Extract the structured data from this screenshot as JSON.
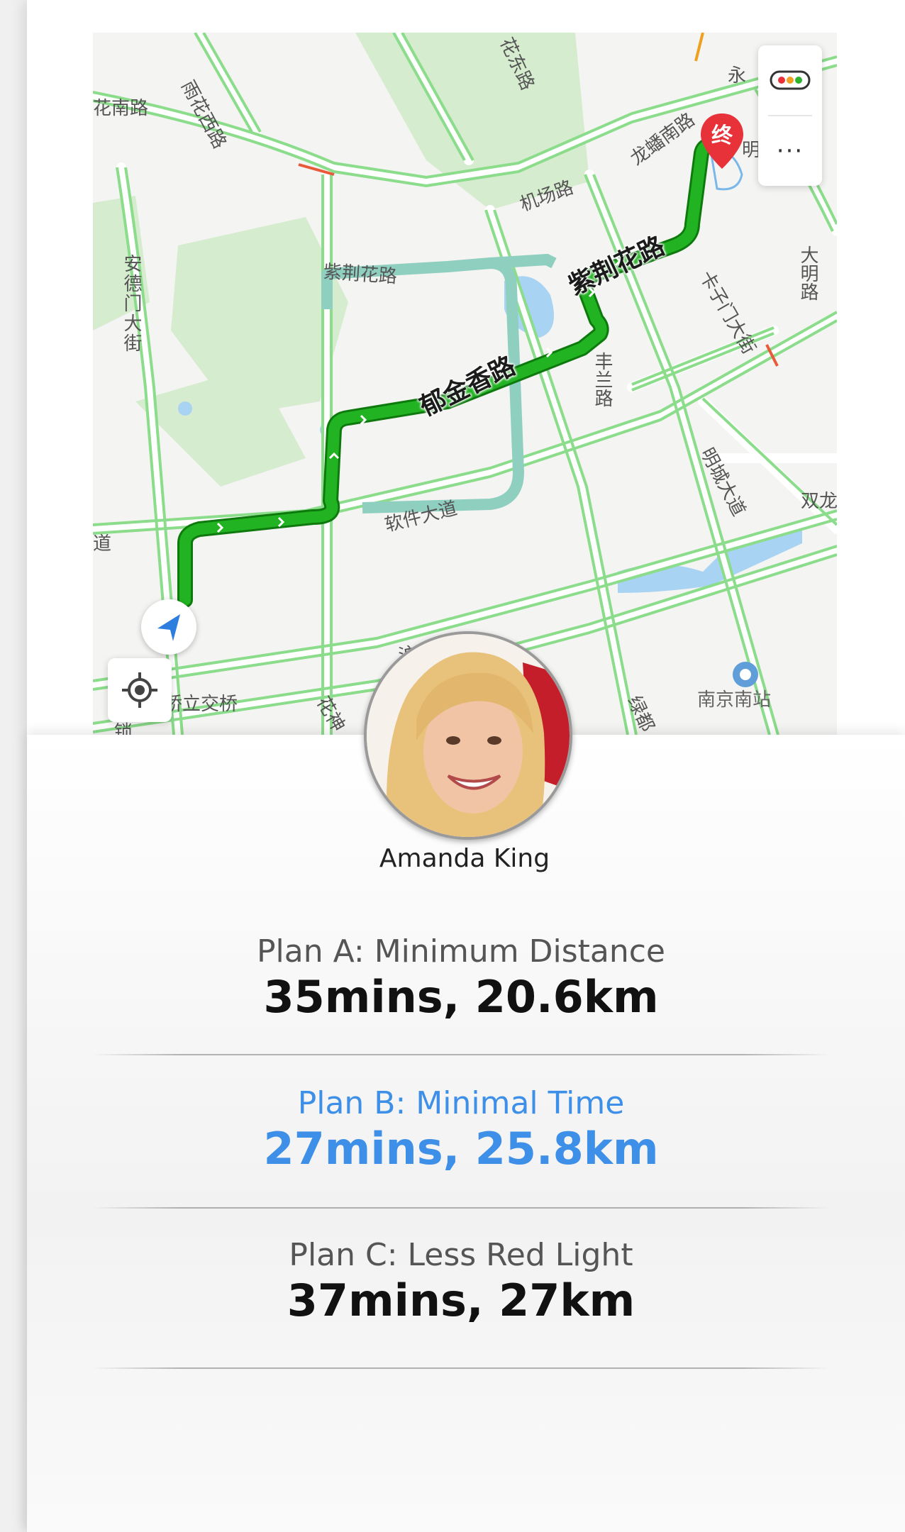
{
  "map": {
    "route_labels": [
      "紫荆花路",
      "郁金香路"
    ],
    "road_labels": [
      "花南路",
      "雨花西路",
      "花东路",
      "机场路",
      "龙蟠南路",
      "永",
      "明",
      "安德门大街",
      "紫荆花路",
      "丰兰路",
      "卡子门大街",
      "大明路",
      "软件大道",
      "明城大道",
      "双龙",
      "道",
      "沪蓉高速",
      "桥立交桥",
      "花神",
      "绿都",
      "锁"
    ],
    "station_label": "南京南站",
    "end_marker": "终",
    "more_label": "···",
    "colors": {
      "route_main": "#1aa31a",
      "route_alt": "#8fcfc0",
      "road_green": "#7dd87d",
      "park": "#d6eccf",
      "water": "#a9d3f2"
    },
    "icons": [
      "traffic-light-icon",
      "more-icon",
      "locate-icon",
      "navigation-arrow-icon",
      "destination-pin-icon",
      "train-station-icon"
    ]
  },
  "user": {
    "name": "Amanda King",
    "avatar_icon": "user-avatar"
  },
  "plans": [
    {
      "title": "Plan A: Minimum Distance",
      "value": "35mins, 20.6km",
      "selected": false
    },
    {
      "title": "Plan B: Minimal Time",
      "value": "27mins, 25.8km",
      "selected": true
    },
    {
      "title": "Plan C: Less Red Light",
      "value": "37mins, 27km",
      "selected": false
    }
  ],
  "accent_color": "#3d8fe8"
}
